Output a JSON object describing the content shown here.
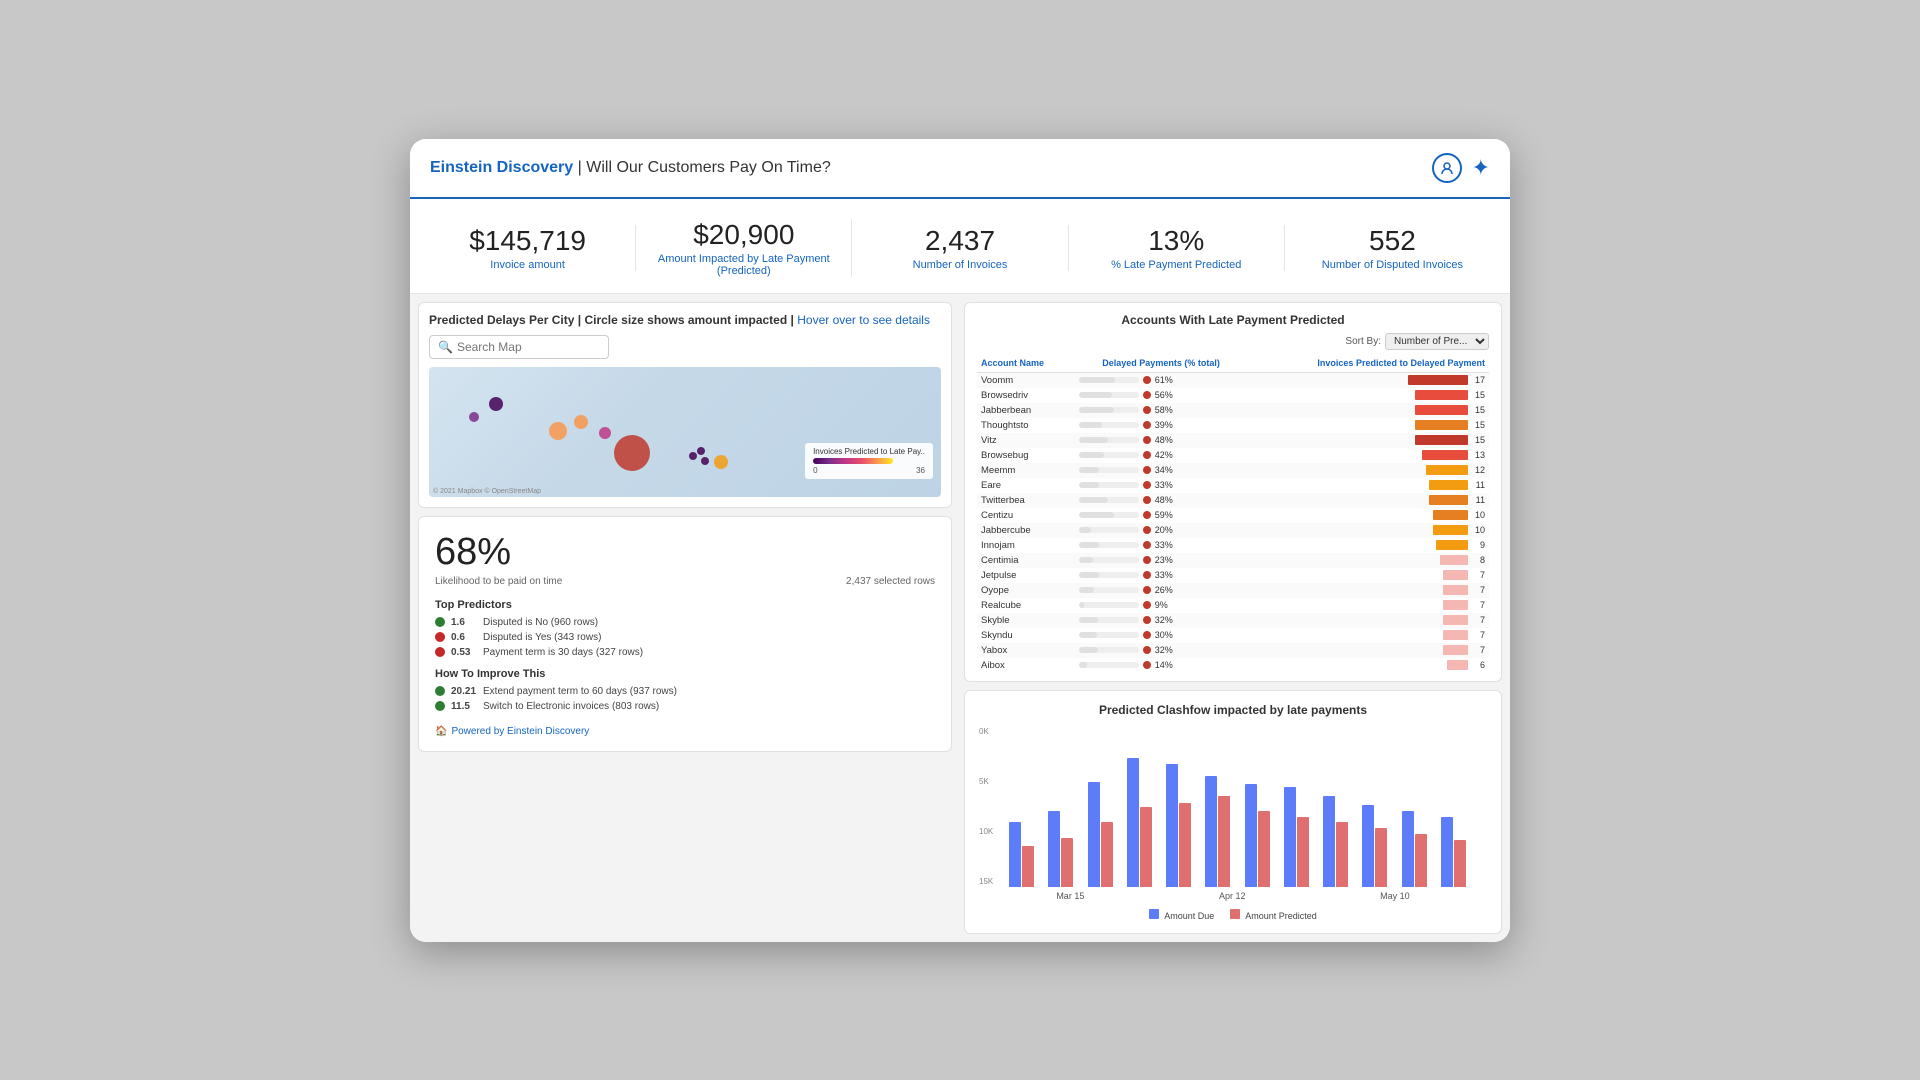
{
  "header": {
    "brand": "Einstein Discovery",
    "separator": " | ",
    "title": "Will Our Customers Pay On Time?"
  },
  "kpis": [
    {
      "value": "$145,719",
      "label": "Invoice amount"
    },
    {
      "value": "$20,900",
      "label": "Amount Impacted by Late Payment (Predicted)"
    },
    {
      "value": "2,437",
      "label": "Number of Invoices"
    },
    {
      "value": "13%",
      "label": "% Late Payment Predicted"
    },
    {
      "value": "552",
      "label": "Number of Disputed Invoices"
    }
  ],
  "map": {
    "title": "Predicted Delays Per City",
    "subtitle": "Circle size shows amount impacted",
    "hover_text": "Hover over to see details",
    "search_placeholder": "Search Map",
    "legend_title": "Invoices Predicted to Late Pay..",
    "legend_min": "0",
    "legend_max": "36",
    "credit": "© 2021 Mapbox © OpenStreetMap"
  },
  "stats": {
    "percent": "68%",
    "label": "Likelihood to be paid on time",
    "rows": "2,437 selected rows",
    "top_predictors_label": "Top Predictors",
    "predictors": [
      {
        "value": "1.6",
        "text": "Disputed is No (960 rows)",
        "positive": true
      },
      {
        "value": "0.6",
        "text": "Disputed is Yes (343 rows)",
        "positive": false
      },
      {
        "value": "0.53",
        "text": "Payment term is 30 days (327 rows)",
        "positive": false
      }
    ],
    "improve_label": "How To Improve This",
    "improvements": [
      {
        "value": "20.21",
        "text": "Extend payment term to 60 days (937 rows)",
        "positive": true
      },
      {
        "value": "11.5",
        "text": "Switch to Electronic invoices (803 rows)",
        "positive": true
      }
    ],
    "powered_label": "Powered by Einstein Discovery"
  },
  "cashflow": {
    "title": "Predicted Clashfow impacted by late payments",
    "y_labels": [
      "15K",
      "10K",
      "5K",
      "0K"
    ],
    "x_labels": [
      "Mar 15",
      "Apr 12",
      "May 10"
    ],
    "legend": [
      {
        "label": "Amount Due",
        "color": "#5c7cfa"
      },
      {
        "label": "Amount Predicted",
        "color": "#e07070"
      }
    ],
    "bars": [
      {
        "blue": 55,
        "red": 35
      },
      {
        "blue": 65,
        "red": 42
      },
      {
        "blue": 90,
        "red": 55
      },
      {
        "blue": 110,
        "red": 68
      },
      {
        "blue": 105,
        "red": 72
      },
      {
        "blue": 95,
        "red": 78
      },
      {
        "blue": 88,
        "red": 65
      },
      {
        "blue": 85,
        "red": 60
      },
      {
        "blue": 78,
        "red": 55
      },
      {
        "blue": 70,
        "red": 50
      },
      {
        "blue": 65,
        "red": 45
      },
      {
        "blue": 60,
        "red": 40
      }
    ]
  },
  "accounts": {
    "title": "Accounts With Late Payment Predicted",
    "sort_label": "Sort By:",
    "sort_value": "Number of Pre...",
    "col1": "Account Name",
    "col2": "Delayed Payments (% total)",
    "col3": "Invoices Predicted to Delayed Payment",
    "rows": [
      {
        "name": "Voomm",
        "pct": 61,
        "inv": 17,
        "color": "#c0392b"
      },
      {
        "name": "Browsedriv",
        "pct": 56,
        "inv": 15,
        "color": "#e74c3c"
      },
      {
        "name": "Jabberbean",
        "pct": 58,
        "inv": 15,
        "color": "#e74c3c"
      },
      {
        "name": "Thoughtsto",
        "pct": 39,
        "inv": 15,
        "color": "#e67e22"
      },
      {
        "name": "Vitz",
        "pct": 48,
        "inv": 15,
        "color": "#c0392b"
      },
      {
        "name": "Browsebug",
        "pct": 42,
        "inv": 13,
        "color": "#e74c3c"
      },
      {
        "name": "Meemm",
        "pct": 34,
        "inv": 12,
        "color": "#f39c12"
      },
      {
        "name": "Eare",
        "pct": 33,
        "inv": 11,
        "color": "#f39c12"
      },
      {
        "name": "Twitterbea",
        "pct": 48,
        "inv": 11,
        "color": "#e67e22"
      },
      {
        "name": "Centizu",
        "pct": 59,
        "inv": 10,
        "color": "#e67e22"
      },
      {
        "name": "Jabbercube",
        "pct": 20,
        "inv": 10,
        "color": "#f39c12"
      },
      {
        "name": "Innojam",
        "pct": 33,
        "inv": 9,
        "color": "#f39c12"
      },
      {
        "name": "Centimia",
        "pct": 23,
        "inv": 8,
        "color": "#f5b7b1"
      },
      {
        "name": "Jetpulse",
        "pct": 33,
        "inv": 7,
        "color": "#f5b7b1"
      },
      {
        "name": "Oyope",
        "pct": 26,
        "inv": 7,
        "color": "#f5b7b1"
      },
      {
        "name": "Realcube",
        "pct": 9,
        "inv": 7,
        "color": "#f5b7b1"
      },
      {
        "name": "Skyble",
        "pct": 32,
        "inv": 7,
        "color": "#f5b7b1"
      },
      {
        "name": "Skyndu",
        "pct": 30,
        "inv": 7,
        "color": "#f5b7b1"
      },
      {
        "name": "Yabox",
        "pct": 32,
        "inv": 7,
        "color": "#f5b7b1"
      },
      {
        "name": "Aibox",
        "pct": 14,
        "inv": 6,
        "color": "#f5b7b1"
      }
    ]
  },
  "colors": {
    "brand_blue": "#1565c0",
    "accent": "#1565c0"
  }
}
